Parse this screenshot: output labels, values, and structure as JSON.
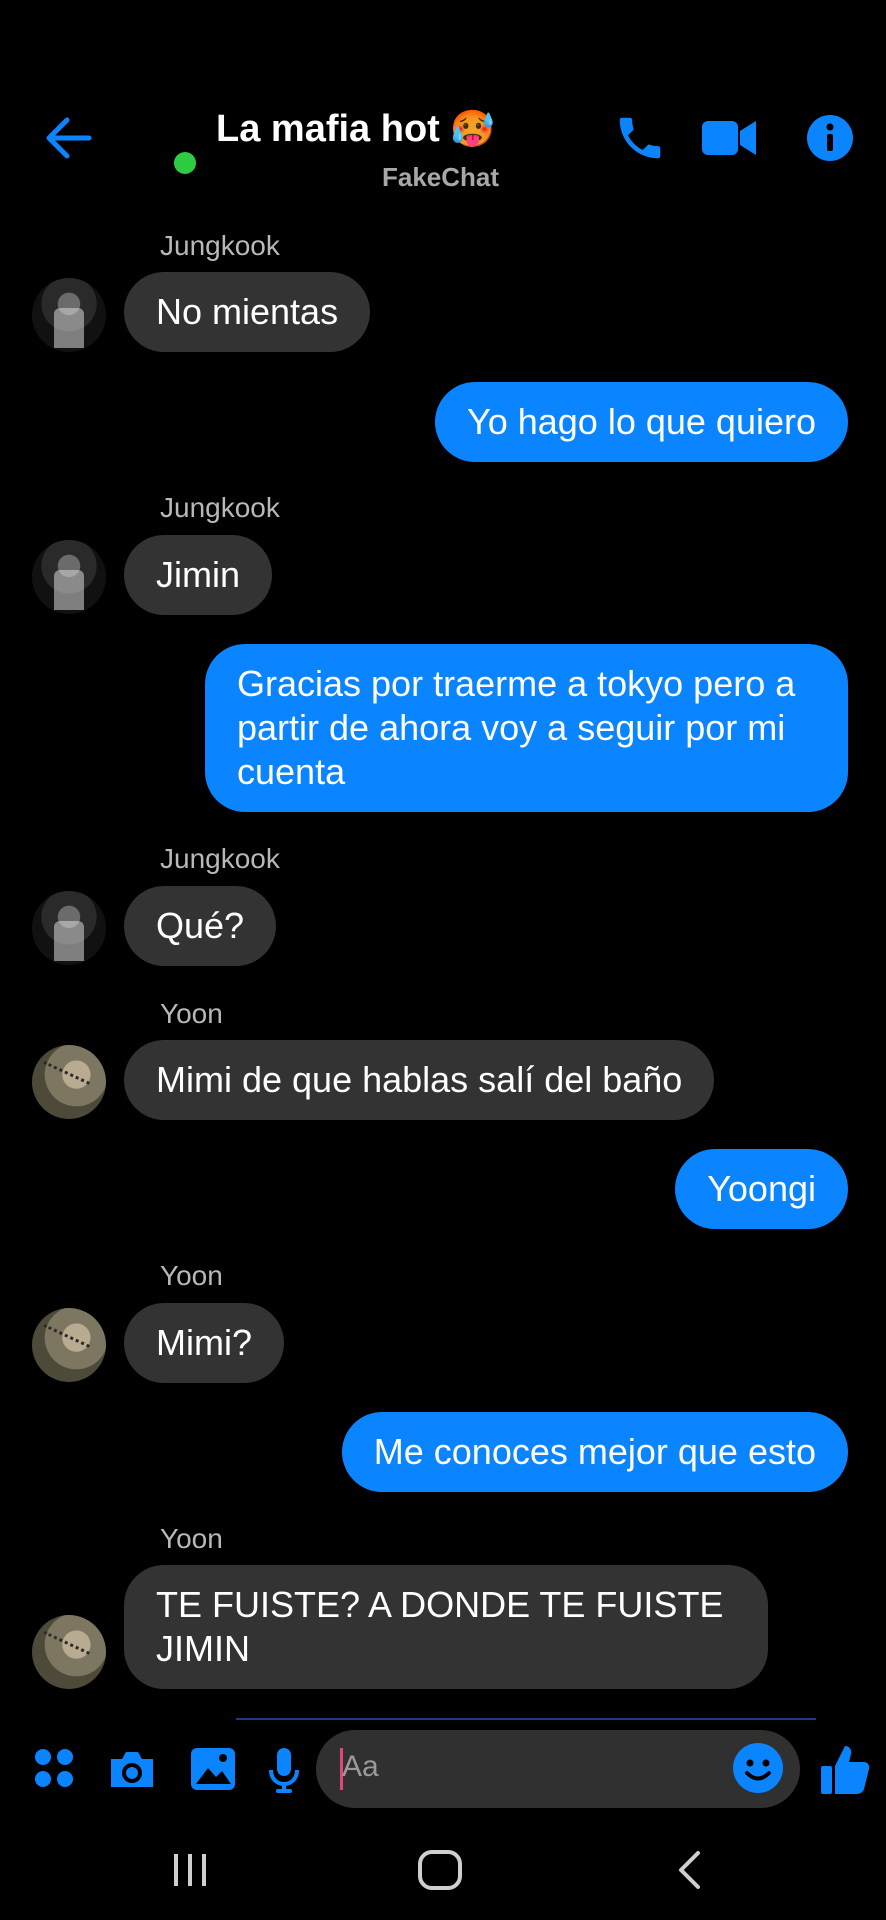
{
  "header": {
    "title": "La mafia hot",
    "title_emoji": "🥵",
    "subtitle": "FakeChat",
    "icons": [
      "back-arrow-icon",
      "phone-icon",
      "video-camera-icon",
      "info-icon"
    ],
    "accent_color": "#0a84ff",
    "online_color": "#2ecc40"
  },
  "messages": [
    {
      "sender": "Jungkook",
      "text": "No mientas",
      "direction": "in"
    },
    {
      "text": "Yo hago lo que quiero",
      "direction": "out"
    },
    {
      "sender": "Jungkook",
      "text": "Jimin",
      "direction": "in"
    },
    {
      "text": "Gracias por traerme a tokyo pero a partir de ahora voy a seguir por mi cuenta",
      "direction": "out"
    },
    {
      "sender": "Jungkook",
      "text": "Qué?",
      "direction": "in"
    },
    {
      "sender": "Yoon",
      "text": "Mimi de que hablas salí del baño",
      "direction": "in"
    },
    {
      "text": "Yoongi",
      "direction": "out"
    },
    {
      "sender": "Yoon",
      "text": "Mimi?",
      "direction": "in"
    },
    {
      "text": "Me conoces mejor que esto",
      "direction": "out"
    },
    {
      "sender": "Yoon",
      "text": "TE FUISTE? A DONDE TE FUISTE JIMIN",
      "direction": "in"
    }
  ],
  "composer": {
    "placeholder": "Aa",
    "icons": [
      "apps-grid-icon",
      "camera-icon",
      "image-icon",
      "microphone-icon",
      "emoji-icon",
      "thumbs-up-icon"
    ]
  },
  "system_nav": {
    "icons": [
      "recent-apps-icon",
      "home-icon",
      "back-icon"
    ]
  }
}
